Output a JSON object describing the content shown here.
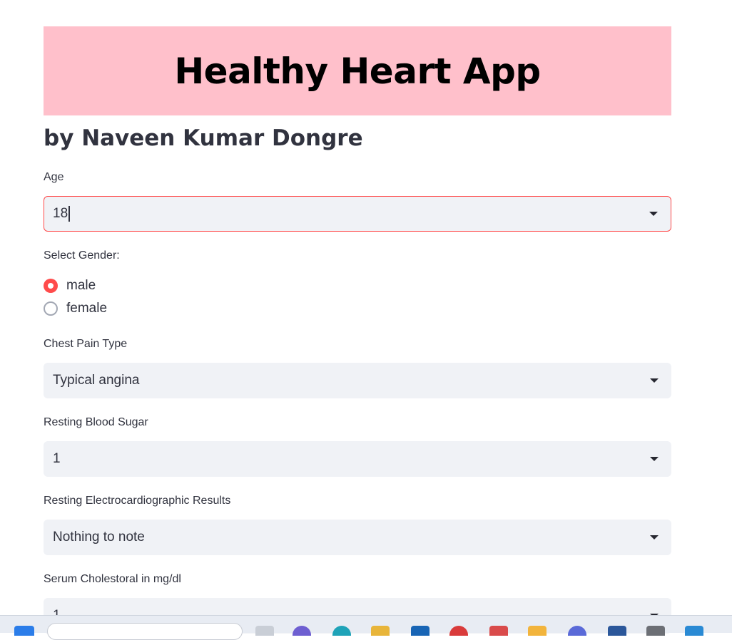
{
  "header": {
    "title": "Healthy Heart App",
    "subtitle": "by Naveen Kumar Dongre"
  },
  "form": {
    "age": {
      "label": "Age",
      "value": "18"
    },
    "gender": {
      "label": "Select Gender:",
      "options": [
        "male",
        "female"
      ],
      "selected": "male"
    },
    "chest_pain": {
      "label": "Chest Pain Type",
      "value": "Typical angina"
    },
    "blood_sugar": {
      "label": "Resting Blood Sugar",
      "value": "1"
    },
    "ecg": {
      "label": "Resting Electrocardiographic Results",
      "value": "Nothing to note"
    },
    "cholesterol": {
      "label": "Serum Cholestoral in mg/dl",
      "value": "1"
    }
  },
  "colors": {
    "banner": "#ffc0cb",
    "accent": "#ff4b4b",
    "input_bg": "#f0f2f6"
  }
}
